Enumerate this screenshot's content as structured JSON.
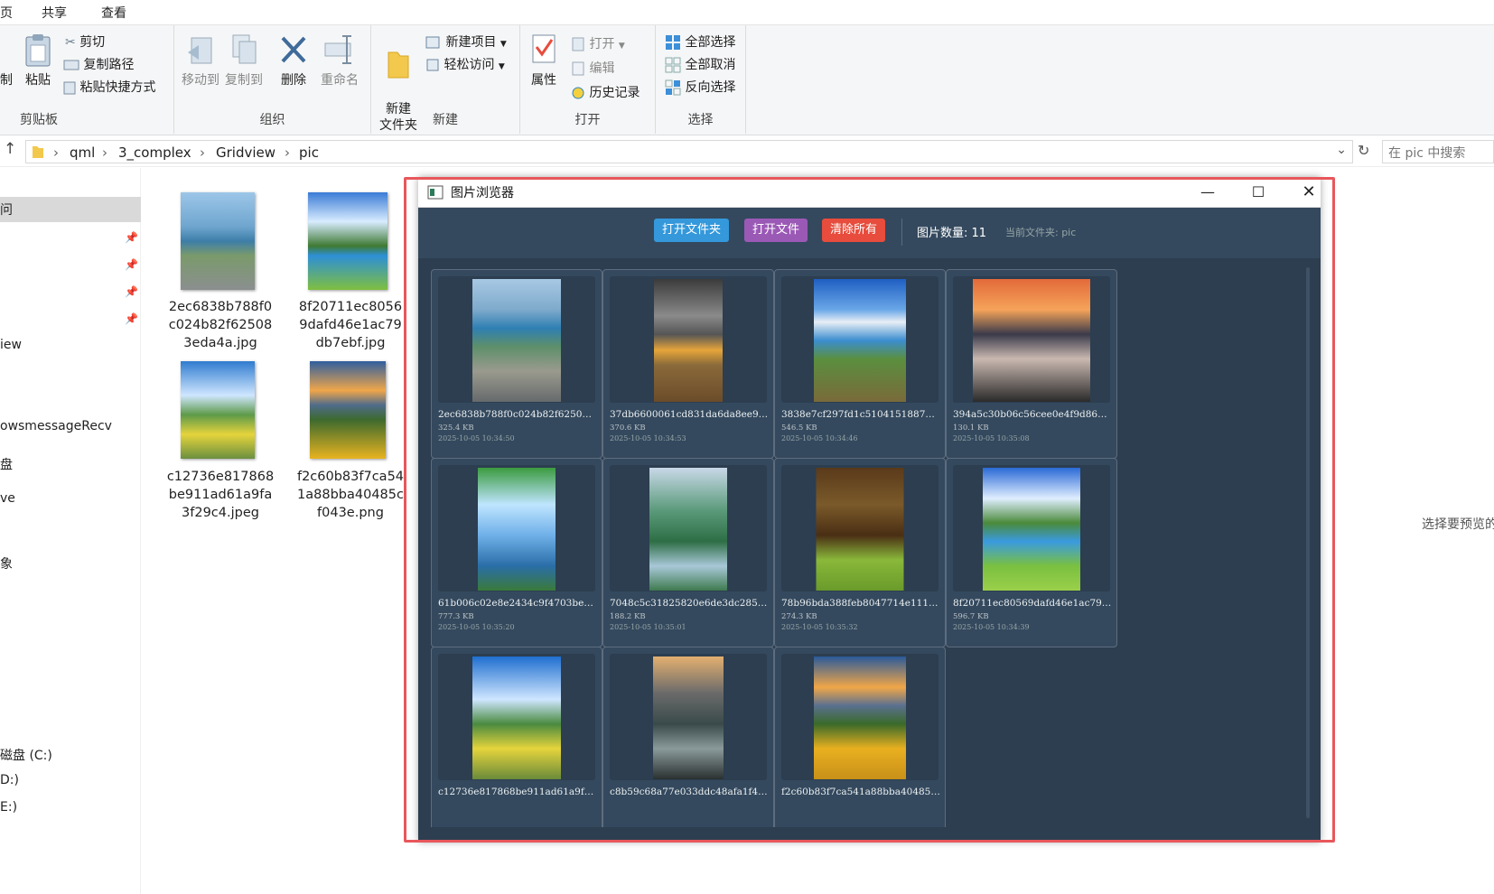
{
  "explorer": {
    "tabs": [
      "页",
      "共享",
      "查看"
    ],
    "clipboard": {
      "label": "剪贴板",
      "paste": "粘贴",
      "cut": "剪切",
      "copy_path": "复制路径",
      "paste_shortcut": "粘贴快捷方式",
      "left_cut": "制"
    },
    "organize": {
      "label": "组织",
      "move_to": "移动到",
      "copy_to": "复制到",
      "delete": "删除",
      "rename": "重命名"
    },
    "new": {
      "label": "新建",
      "new_folder": "新建\n文件夹",
      "new_item": "新建项目",
      "easy_access": "轻松访问"
    },
    "open": {
      "label": "打开",
      "properties": "属性",
      "open": "打开",
      "edit": "编辑",
      "history": "历史记录"
    },
    "select": {
      "label": "选择",
      "select_all": "全部选择",
      "select_none": "全部取消",
      "invert": "反向选择"
    },
    "breadcrumb": [
      "qml",
      "3_complex",
      "Gridview",
      "pic"
    ],
    "search_placeholder": "在 pic 中搜索",
    "nav_items": [
      "问",
      "iew",
      "owsmessageRecv",
      "盘",
      "ve",
      "象",
      "磁盘 (C:)",
      "D:)",
      "E:)"
    ],
    "files": [
      {
        "name": "2ec6838b788f0c024b82f625083eda4a.jpg"
      },
      {
        "name": "8f20711ec80569dafd46e1ac79db7ebf.jpg"
      },
      {
        "name": "c12736e817868be911ad61a9fa3f29c4.jpeg"
      },
      {
        "name": "f2c60b83f7ca541a88bba40485cf043e.png"
      }
    ],
    "preview_text": "选择要预览的"
  },
  "app": {
    "title": "图片浏览器",
    "buttons": {
      "open_folder": "打开文件夹",
      "open_file": "打开文件",
      "clear_all": "清除所有"
    },
    "count_label": "图片数量: 11",
    "folder_label": "当前文件夹: pic",
    "colors": {
      "bg": "#2c3e50",
      "toolbar": "#34495e",
      "open_folder": "#3498db",
      "open_file": "#9b59b6",
      "clear_all": "#e74c3c",
      "highlight_frame": "#e8575b"
    },
    "images": [
      {
        "name": "2ec6838b788f0c024b82f62508…",
        "size": "325.4 KB",
        "date": "2025-10-05 10:34:50",
        "theme": "coast-road"
      },
      {
        "name": "37db6600061cd831da6da8ee99…",
        "size": "370.6 KB",
        "date": "2025-10-05 10:34:53",
        "theme": "storm-field"
      },
      {
        "name": "3838e7cf297fd1c5104151887b…",
        "size": "546.5 KB",
        "date": "2025-10-05 10:34:46",
        "theme": "alpine-village"
      },
      {
        "name": "394a5c30b06c56cee0e4f9d86c…",
        "size": "130.1 KB",
        "date": "2025-10-05 10:35:08",
        "theme": "sunset-mountain"
      },
      {
        "name": "61b006c02e8e2434c9f4703be8…",
        "size": "777.3 KB",
        "date": "2025-10-05 10:35:20",
        "theme": "willow-lake"
      },
      {
        "name": "7048c5c31825820e6de3dc2857…",
        "size": "188.2 KB",
        "date": "2025-10-05 10:35:01",
        "theme": "karst-hills"
      },
      {
        "name": "78b96bda388feb8047714e1115…",
        "size": "274.3 KB",
        "date": "2025-10-05 10:35:32",
        "theme": "forest-trunks"
      },
      {
        "name": "8f20711ec80569dafd46e1ac79…",
        "size": "596.7 KB",
        "date": "2025-10-05 10:34:39",
        "theme": "lake-meadow"
      },
      {
        "name": "c12736e817868be911ad61a9fa…",
        "size": "",
        "date": "",
        "theme": "sunny-path"
      },
      {
        "name": "c8b59c68a77e033ddc48afa1f4…",
        "size": "",
        "date": "",
        "theme": "river-town"
      },
      {
        "name": "f2c60b83f7ca541a88bba40485…",
        "size": "",
        "date": "",
        "theme": "flower-valley"
      }
    ]
  }
}
